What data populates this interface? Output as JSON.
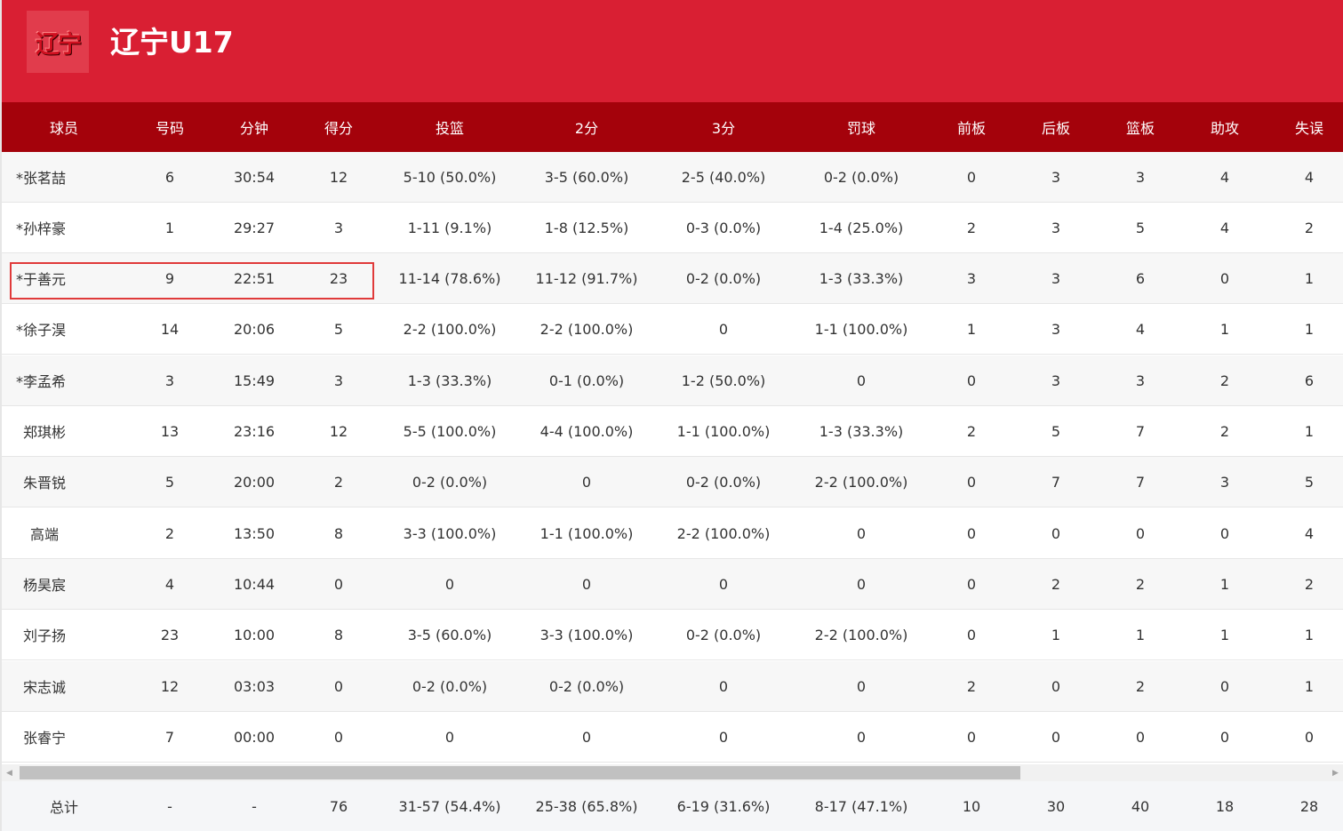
{
  "team": {
    "logo_text": "辽宁",
    "name": "辽宁U17"
  },
  "columns": [
    "球员",
    "号码",
    "分钟",
    "得分",
    "投篮",
    "2分",
    "3分",
    "罚球",
    "前板",
    "后板",
    "篮板",
    "助攻",
    "失误"
  ],
  "players": [
    {
      "name": "*张茗喆",
      "num": "6",
      "min": "30:54",
      "pts": "12",
      "fg": "5-10 (50.0%)",
      "p2": "3-5 (60.0%)",
      "p3": "2-5 (40.0%)",
      "ft": "0-2 (0.0%)",
      "oreb": "0",
      "dreb": "3",
      "reb": "3",
      "ast": "4",
      "tov": "4"
    },
    {
      "name": "*孙梓豪",
      "num": "1",
      "min": "29:27",
      "pts": "3",
      "fg": "1-11 (9.1%)",
      "p2": "1-8 (12.5%)",
      "p3": "0-3 (0.0%)",
      "ft": "1-4 (25.0%)",
      "oreb": "2",
      "dreb": "3",
      "reb": "5",
      "ast": "4",
      "tov": "2"
    },
    {
      "name": "*于善元",
      "num": "9",
      "min": "22:51",
      "pts": "23",
      "fg": "11-14 (78.6%)",
      "p2": "11-12 (91.7%)",
      "p3": "0-2 (0.0%)",
      "ft": "1-3 (33.3%)",
      "oreb": "3",
      "dreb": "3",
      "reb": "6",
      "ast": "0",
      "tov": "1"
    },
    {
      "name": "*徐子淏",
      "num": "14",
      "min": "20:06",
      "pts": "5",
      "fg": "2-2 (100.0%)",
      "p2": "2-2 (100.0%)",
      "p3": "0",
      "ft": "1-1 (100.0%)",
      "oreb": "1",
      "dreb": "3",
      "reb": "4",
      "ast": "1",
      "tov": "1"
    },
    {
      "name": "*李孟希",
      "num": "3",
      "min": "15:49",
      "pts": "3",
      "fg": "1-3 (33.3%)",
      "p2": "0-1 (0.0%)",
      "p3": "1-2 (50.0%)",
      "ft": "0",
      "oreb": "0",
      "dreb": "3",
      "reb": "3",
      "ast": "2",
      "tov": "6"
    },
    {
      "name": "郑琪彬",
      "num": "13",
      "min": "23:16",
      "pts": "12",
      "fg": "5-5 (100.0%)",
      "p2": "4-4 (100.0%)",
      "p3": "1-1 (100.0%)",
      "ft": "1-3 (33.3%)",
      "oreb": "2",
      "dreb": "5",
      "reb": "7",
      "ast": "2",
      "tov": "1"
    },
    {
      "name": "朱晋锐",
      "num": "5",
      "min": "20:00",
      "pts": "2",
      "fg": "0-2 (0.0%)",
      "p2": "0",
      "p3": "0-2 (0.0%)",
      "ft": "2-2 (100.0%)",
      "oreb": "0",
      "dreb": "7",
      "reb": "7",
      "ast": "3",
      "tov": "5"
    },
    {
      "name": "高端",
      "num": "2",
      "min": "13:50",
      "pts": "8",
      "fg": "3-3 (100.0%)",
      "p2": "1-1 (100.0%)",
      "p3": "2-2 (100.0%)",
      "ft": "0",
      "oreb": "0",
      "dreb": "0",
      "reb": "0",
      "ast": "0",
      "tov": "4"
    },
    {
      "name": "杨昊宸",
      "num": "4",
      "min": "10:44",
      "pts": "0",
      "fg": "0",
      "p2": "0",
      "p3": "0",
      "ft": "0",
      "oreb": "0",
      "dreb": "2",
      "reb": "2",
      "ast": "1",
      "tov": "2"
    },
    {
      "name": "刘子扬",
      "num": "23",
      "min": "10:00",
      "pts": "8",
      "fg": "3-5 (60.0%)",
      "p2": "3-3 (100.0%)",
      "p3": "0-2 (0.0%)",
      "ft": "2-2 (100.0%)",
      "oreb": "0",
      "dreb": "1",
      "reb": "1",
      "ast": "1",
      "tov": "1"
    },
    {
      "name": "宋志诚",
      "num": "12",
      "min": "03:03",
      "pts": "0",
      "fg": "0-2 (0.0%)",
      "p2": "0-2 (0.0%)",
      "p3": "0",
      "ft": "0",
      "oreb": "2",
      "dreb": "0",
      "reb": "2",
      "ast": "0",
      "tov": "1"
    },
    {
      "name": "张睿宁",
      "num": "7",
      "min": "00:00",
      "pts": "0",
      "fg": "0",
      "p2": "0",
      "p3": "0",
      "ft": "0",
      "oreb": "0",
      "dreb": "0",
      "reb": "0",
      "ast": "0",
      "tov": "0"
    }
  ],
  "totals": {
    "name": "总计",
    "num": "-",
    "min": "-",
    "pts": "76",
    "fg": "31-57 (54.4%)",
    "p2": "25-38 (65.8%)",
    "p3": "6-19 (31.6%)",
    "ft": "8-17 (47.1%)",
    "oreb": "10",
    "dreb": "30",
    "reb": "40",
    "ast": "18",
    "tov": "28"
  },
  "colors": {
    "header_bg": "#d91f33",
    "column_header_bg": "#a4020b",
    "highlight": "#e03a3a"
  }
}
